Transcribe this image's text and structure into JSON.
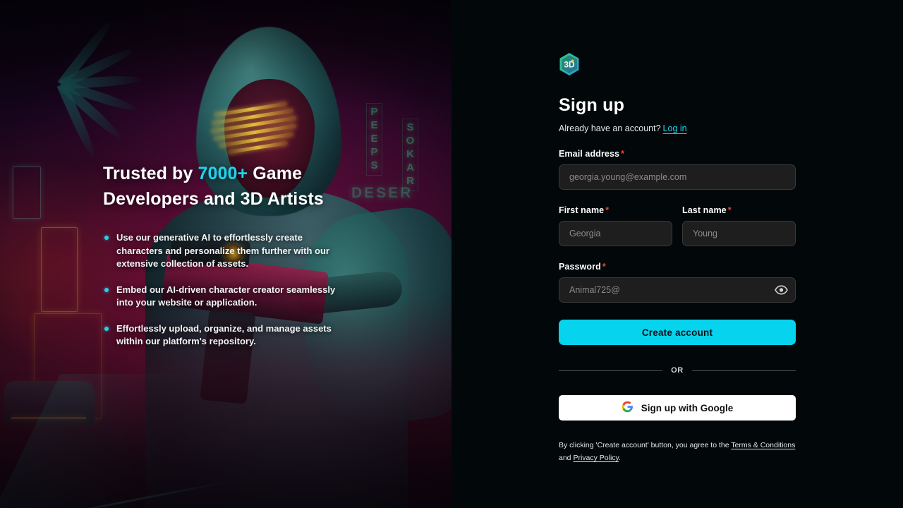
{
  "promo": {
    "heading_pre": "Trusted by ",
    "heading_highlight": "7000+",
    "heading_post": " Game Developers and 3D Artists",
    "bullets": [
      "Use our generative AI to effortlessly create characters and personalize them further with our extensive collection of assets.",
      "Embed our AI-driven character creator seamlessly into your website or application.",
      "Effortlessly upload, organize, and manage assets within our platform's repository."
    ],
    "art": {
      "neon_sign_1": "PEEPS",
      "neon_sign_2": "SOKAR",
      "neon_sign_3": "DESER"
    }
  },
  "form": {
    "logo_text": "3D",
    "title": "Sign up",
    "subtitle_text": "Already have an account?",
    "login_link": "Log in",
    "email": {
      "label": "Email address",
      "required_marker": "*",
      "placeholder": "georgia.young@example.com",
      "value": ""
    },
    "first_name": {
      "label": "First name",
      "required_marker": "*",
      "placeholder": "Georgia",
      "value": ""
    },
    "last_name": {
      "label": "Last name",
      "required_marker": "*",
      "placeholder": "Young",
      "value": ""
    },
    "password": {
      "label": "Password",
      "required_marker": "*",
      "placeholder": "Animal725@",
      "value": "",
      "toggle_icon": "eye-icon"
    },
    "submit_label": "Create account",
    "divider_label": "OR",
    "google_label": "Sign up with Google",
    "google_icon": "google-g-icon",
    "legal": {
      "prefix": "By clicking 'Create account' button, you agree to the ",
      "terms_link": "Terms & Conditions",
      "conjunction": " and ",
      "privacy_link": "Privacy Policy",
      "suffix": "."
    }
  },
  "colors": {
    "accent": "#06d3ee",
    "link": "#22d3ee",
    "required": "#e8453c",
    "panel_bg": "#020809",
    "input_bg": "#1f1e1e",
    "input_border": "#3a3838"
  }
}
